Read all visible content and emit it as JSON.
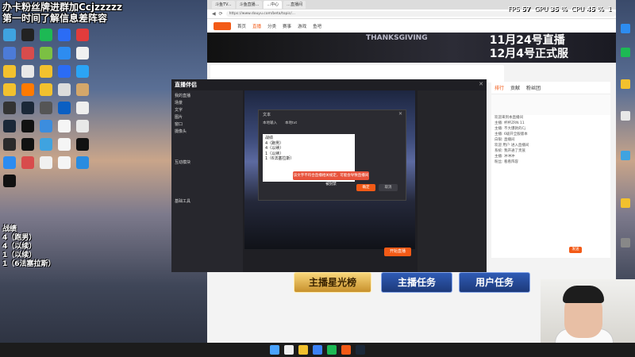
{
  "overlay": {
    "banner_line1": "办卡粉丝牌进群加Ccjzzzzz",
    "banner_line2": "第一时间了解信息差阵容",
    "battle_title": "战绩",
    "battle_lines": [
      "4（跑男）",
      "4（以续）",
      "1（以续）",
      "1（6法塞拉斯）"
    ]
  },
  "perf": {
    "fps_label": "FPS",
    "fps": "57",
    "gpu_label": "GPU",
    "gpu": "35 %",
    "cpu_label": "CPU",
    "cpu": "45 %",
    "extra": "1"
  },
  "browser": {
    "tabs": [
      "斗鱼TV...",
      "斗鱼直播...",
      "...中心",
      "...直播间"
    ],
    "url": "https://www.douyu.com/beta/topic/...",
    "nav": [
      "首页",
      "直播",
      "分类",
      "赛事",
      "游戏",
      "鱼吧"
    ],
    "promo_line1": "11月24号直播",
    "promo_line2": "12月4号正式服",
    "promo_sub": "THANKSGIVING",
    "chat_tabs": [
      "排行",
      "贡献",
      "粉丝团"
    ],
    "chat_lines": [
      "欢迎来到本直播间",
      "主播: 杯杯ZRN 11",
      "主播: 不大爆款的Cj",
      "主播: 6级开全服版本",
      "白银: 直播间",
      "欢迎 用户 进入直播间",
      "系统: 我开通了贵族",
      "主播: 冲冲冲",
      "粉丝: 看看阵容"
    ],
    "chat_send": "发送"
  },
  "tool": {
    "title": "直播伴侣",
    "side_items": [
      "我的直播",
      "场景",
      "文字",
      "图片",
      "窗口",
      "摄像头",
      "互动模块",
      "基础工具"
    ],
    "dialog_title": "文本",
    "dialog_tabs": [
      "本地输入",
      "本地txt"
    ],
    "textbox_lines": [
      "战绩",
      "4（跑男）",
      "4（以续）",
      "1（以续）",
      "1（6法塞拉斯）"
    ],
    "warning": "该文字不符合直播相关规定，可能会导致直播间被封禁",
    "ok": "确定",
    "cancel": "取消",
    "go_live": "开始直播"
  },
  "stream_buttons": [
    "主播星光榜",
    "主播任务",
    "用户任务"
  ]
}
